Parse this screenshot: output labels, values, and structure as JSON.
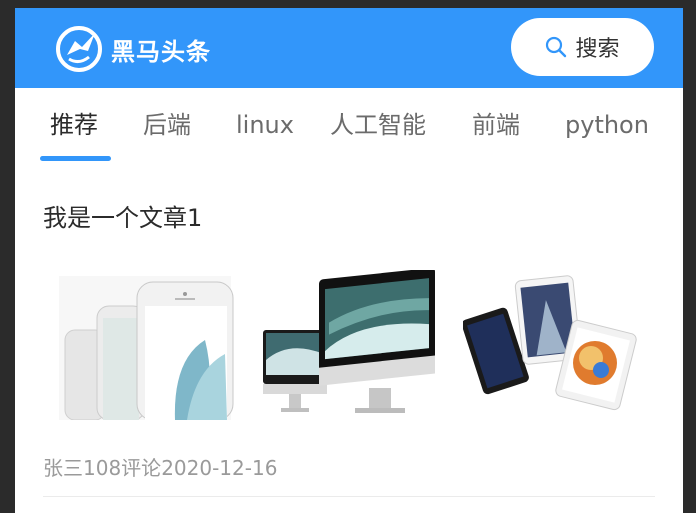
{
  "header": {
    "app_name": "黑马头条",
    "search_label": "搜索",
    "icons": {
      "logo": "horse-logo-icon",
      "search": "search-icon"
    },
    "colors": {
      "brand": "#3296fa"
    }
  },
  "tabs": {
    "active_index": 0,
    "items": [
      {
        "label": "推荐"
      },
      {
        "label": "后端"
      },
      {
        "label": "linux"
      },
      {
        "label": "人工智能"
      },
      {
        "label": "前端"
      },
      {
        "label": "python"
      }
    ]
  },
  "article": {
    "title": "我是一个文章1",
    "author": "张三",
    "comments": "108评论",
    "date": "2020-12-16",
    "images": [
      {
        "name": "iphone-image"
      },
      {
        "name": "imac-image"
      },
      {
        "name": "ipad-image"
      }
    ]
  }
}
